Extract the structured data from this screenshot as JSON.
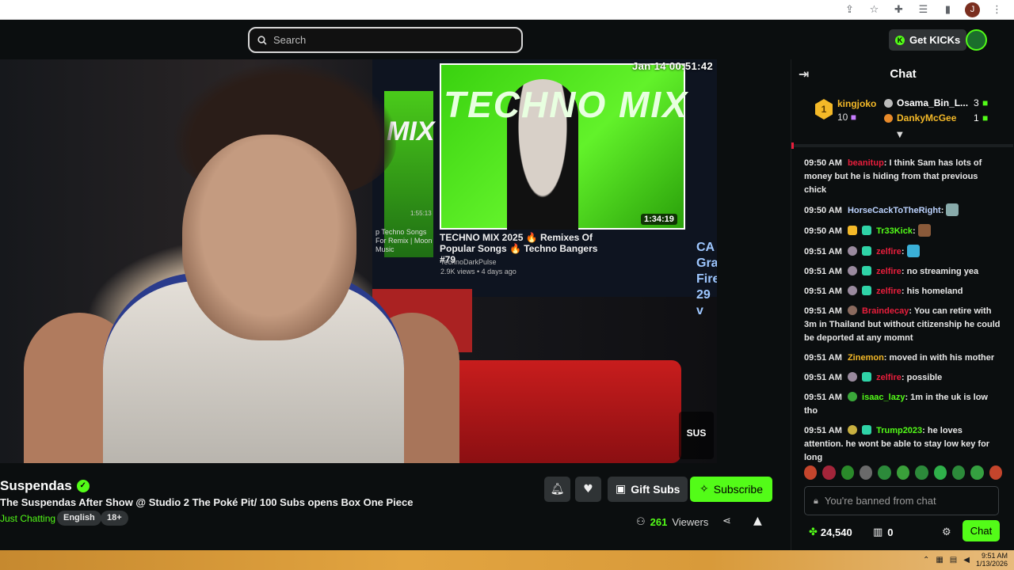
{
  "browser": {
    "profile_initial": "J"
  },
  "topnav": {
    "search_placeholder": "Search",
    "get_kicks_label": "Get KICKs"
  },
  "video": {
    "timestamp": "Jan 14  00:51:42",
    "tv": {
      "title": "TECHNO MIX",
      "left_title": "MIX",
      "duration": "1:34:19",
      "left_duration": "1:55:13",
      "caption": "TECHNO MIX 2025 🔥 Remixes Of Popular Songs 🔥 Techno Bangers #79",
      "channel": "TechnoDarkPulse",
      "meta": "2.9K views • 4 days ago",
      "left_caption": "p Techno Songs For Remix | Moon Music",
      "right_caption_1": "CA",
      "right_caption_2": "Gra",
      "right_caption_3": "Fire",
      "right_caption_4": "29 v"
    },
    "overlay_badge": "SUS"
  },
  "stream": {
    "streamer": "Suspendas",
    "title": "The Suspendas After Show @ Studio 2 The Poké Pit/ 100 Subs opens Box One Piece",
    "category": "Just Chatting",
    "tags": [
      "English",
      "18+"
    ],
    "gift_label": "Gift Subs",
    "subscribe_label": "Subscribe",
    "viewer_count": "261",
    "viewer_label": "Viewers"
  },
  "chat": {
    "header": "Chat",
    "leaderboard": {
      "top": {
        "rank": "1",
        "name": "kingjoko",
        "count": "10"
      },
      "others": [
        {
          "name": "Osama_Bin_L...",
          "count": "3"
        },
        {
          "name": "DankyMcGee",
          "count": "1"
        }
      ]
    },
    "messages": [
      {
        "time": "09:50 AM",
        "user": "beanitup",
        "color": "#e91e3c",
        "text": ": I think Sam has lots of money but he is hiding from that previous chick"
      },
      {
        "time": "09:50 AM",
        "user": "HorseCackToTheRight",
        "color": "#bcd3ff",
        "text": ":"
      },
      {
        "time": "09:50 AM",
        "user": "Tr33Kick",
        "color": "#53fc18",
        "text": ":"
      },
      {
        "time": "09:51 AM",
        "user": "zelfire",
        "color": "#e91e3c",
        "text": ":"
      },
      {
        "time": "09:51 AM",
        "user": "zelfire",
        "color": "#e91e3c",
        "text": ": no streaming yea"
      },
      {
        "time": "09:51 AM",
        "user": "zelfire",
        "color": "#e91e3c",
        "text": ": his homeland"
      },
      {
        "time": "09:51 AM",
        "user": "Braindecay",
        "color": "#e91e3c",
        "text": ": You can retire with 3m in Thailand but without citizenship he could be deported at any momnt"
      },
      {
        "time": "09:51 AM",
        "user": "Zinemon",
        "color": "#f4b928",
        "text": ": moved in with his mother"
      },
      {
        "time": "09:51 AM",
        "user": "zelfire",
        "color": "#e91e3c",
        "text": ": possible"
      },
      {
        "time": "09:51 AM",
        "user": "isaac_lazy",
        "color": "#53fc18",
        "text": ": 1m in the uk is low tho"
      },
      {
        "time": "09:51 AM",
        "user": "Trump2023",
        "color": "#53fc18",
        "text": ": he loves attention. he wont be able to stay low key for long"
      }
    ],
    "input_placeholder": "You're banned from chat",
    "points": "24,540",
    "items_count": "0",
    "send_label": "Chat"
  },
  "taskbar": {
    "time": "9:51 AM",
    "date": "1/13/2026"
  }
}
